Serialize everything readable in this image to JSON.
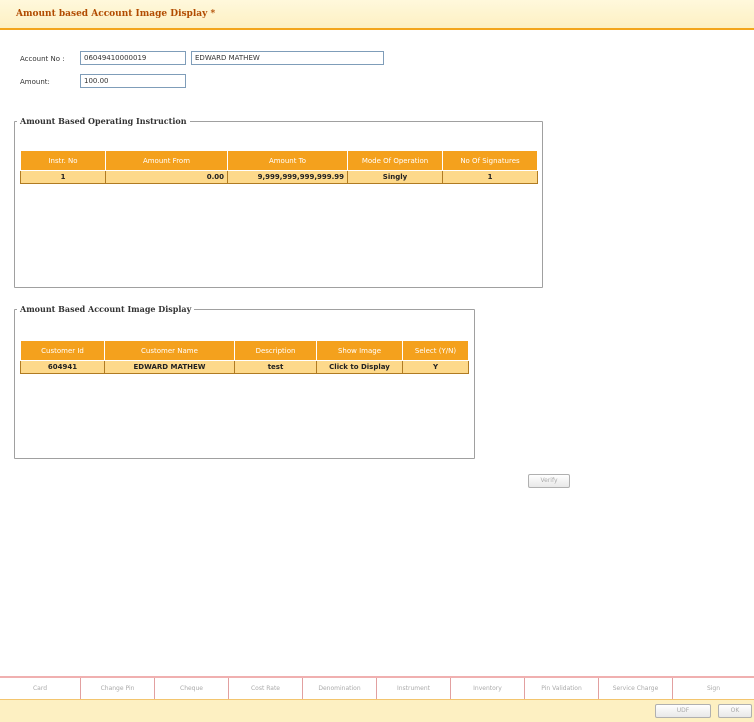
{
  "window": {
    "title": "Amount based Account Image Display *"
  },
  "account": {
    "account_no_label": "Account No :",
    "account_no_value": "06049410000019",
    "account_name_value": "EDWARD MATHEW",
    "amount_label": "Amount:",
    "amount_value": "100.00"
  },
  "operating_instruction": {
    "legend": "Amount Based Operating Instruction",
    "headers": [
      "Instr. No",
      "Amount From",
      "Amount To",
      "Mode Of Operation",
      "No Of Signatures"
    ],
    "rows": [
      [
        "1",
        "0.00",
        "9,999,999,999,999.99",
        "Singly",
        "1"
      ]
    ]
  },
  "image_display": {
    "legend": "Amount Based Account Image Display",
    "headers": [
      "Customer Id",
      "Customer Name",
      "Description",
      "Show Image",
      "Select (Y/N)"
    ],
    "rows": [
      [
        "604941",
        "EDWARD MATHEW",
        "test",
        "Click to Display",
        "Y"
      ]
    ]
  },
  "verify_button": "Verify",
  "tabs": [
    "Card",
    "Change Pin",
    "Cheque",
    "Cost Rate",
    "Denomination",
    "Instrument",
    "Inventory",
    "Pin Validation",
    "Service Charge",
    "Sign"
  ],
  "bottom_buttons": {
    "udf": "UDF",
    "ok": "OK"
  }
}
